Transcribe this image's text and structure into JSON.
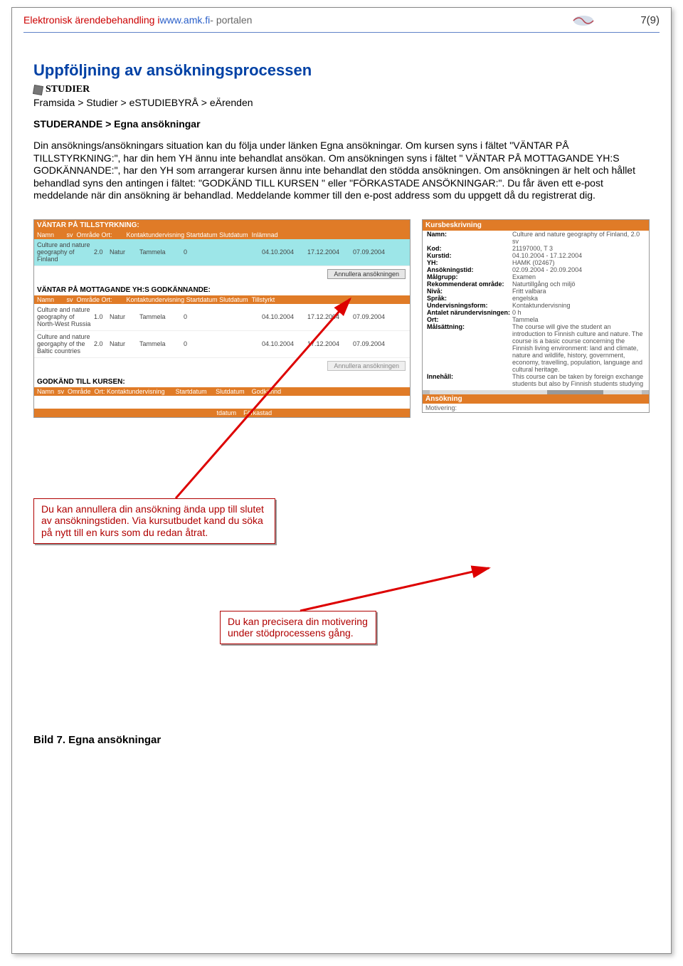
{
  "header": {
    "red": "Elektronisk ärendebehandling i ",
    "blue": "www.amk.fi",
    "grey": " - portalen",
    "page_no": "7(9)"
  },
  "section": {
    "title": "Uppföljning av ansökningsprocessen",
    "studier_label": "STUDIER",
    "crumb1": "Framsida > Studier > eSTUDIEBYRÅ > eÄrenden",
    "crumb2": "STUDERANDE > Egna ansökningar",
    "body": "Din ansöknings/ansökningars situation kan du följa under länken Egna ansökningar. Om kursen syns i fältet \"VÄNTAR PÅ TILLSTYRKNING:\", har din hem YH ännu inte behandlat ansökan. Om ansökningen syns i fältet \" VÄNTAR PÅ MOTTAGANDE YH:S GODKÄNNANDE:\", har den YH som arrangerar kursen ännu inte behandlat den stödda ansökningen. Om ansökningen är helt och hållet behandlad syns den antingen i fältet: \"GODKÄND TILL KURSEN \" eller \"FÖRKASTADE ANSÖKNINGAR:\". Du får även ett e-post meddelande när din ansökning är behandlad. Meddelande kommer till den e-post address som du uppgett då du registrerat dig."
  },
  "shot": {
    "sect1_title": "VÄNTAR PÅ TILLSTYRKNING:",
    "header_row1": "Namn       sv  Område Ort:        Kontaktundervisning Startdatum Slutdatum  Inlämnad",
    "row1": {
      "name": "Culture and nature geography of Finland",
      "sv": "2.0",
      "omr": "Natur",
      "ort": "Tammela",
      "ku": "0",
      "s1": "04.10.2004",
      "s2": "17.12.2004",
      "s3": "07.09.2004"
    },
    "btn_cancel": "Annullera ansökningen",
    "sect2_title": "VÄNTAR PÅ MOTTAGANDE YH:S GODKÄNNANDE:",
    "header_row2": "Namn       sv  Område Ort:        Kontaktundervisning Startdatum Slutdatum  Tillstyrkt",
    "row2a": {
      "name": "Culture and nature geography of North-West Russia",
      "sv": "1.0",
      "omr": "Natur",
      "ort": "Tammela",
      "ku": "0",
      "s1": "04.10.2004",
      "s2": "17.12.2004",
      "s3": "07.09.2004"
    },
    "row2b": {
      "name": "Culture and nature georgaphy of the Baltic countries",
      "sv": "2.0",
      "omr": "Natur",
      "ort": "Tammela",
      "ku": "0",
      "s1": "04.10.2004",
      "s2": "17.12.2004",
      "s3": "07.09.2004"
    },
    "btn_cancel2": "Annullera ansökningen",
    "sect3_title": "GODKÄND TILL KURSEN:",
    "header_row3": "Namn  sv  Område  Ort: Kontaktundervisning      Startdatum     Slutdatum    Godkännd",
    "header_row4": "                                                                                                     tdatum    Förkastad"
  },
  "side": {
    "title": "Kursbeskrivning",
    "rows": [
      {
        "k": "Namn:",
        "v": "Culture and nature geography of Finland, 2.0 sv"
      },
      {
        "k": "Kod:",
        "v": "21197000, T 3"
      },
      {
        "k": "Kurstid:",
        "v": "04.10.2004 - 17.12.2004"
      },
      {
        "k": "YH:",
        "v": "HAMK (02467)"
      },
      {
        "k": "Ansökningstid:",
        "v": "02.09.2004 - 20.09.2004"
      },
      {
        "k": "Målgrupp:",
        "v": "Examen"
      },
      {
        "k": "Rekommenderat område:",
        "v": "Naturtillgång och miljö"
      },
      {
        "k": "Nivå:",
        "v": "Fritt valbara"
      },
      {
        "k": "Språk:",
        "v": "engelska"
      },
      {
        "k": "Undervisningsform:",
        "v": "Kontaktundervisning"
      },
      {
        "k": "Antalet närundervisningen:",
        "v": "0 h"
      },
      {
        "k": "Ort:",
        "v": "Tammela"
      },
      {
        "k": "Målsättning:",
        "v": "The course will give the student an introduction to Finnish culture and nature. The course is a basic course concerning the Finnish living environment: land and climate, nature and wildlife, history, government, economy, travelling, population, language and cultural heritage."
      },
      {
        "k": "Innehåll:",
        "v": "This course can be taken by foreign exchange students but also by Finnish students studying"
      }
    ],
    "ansokning": "Ansökning",
    "motivering": "Motivering:"
  },
  "callouts": {
    "c1": "Du kan annullera din ansökning ända upp till slutet av ansökningstiden.  Via kursutbudet kand du söka på nytt till en kurs som du redan åtrat.",
    "c2": "Du kan precisera din motivering under stödprocessens gång."
  },
  "caption": "Bild 7. Egna ansökningar"
}
